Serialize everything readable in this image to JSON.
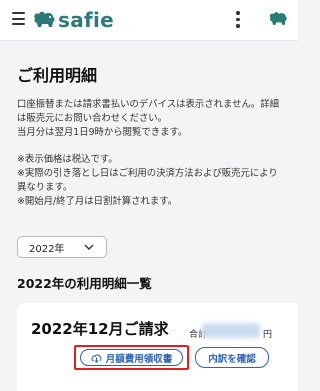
{
  "header": {
    "logo_text": "safie",
    "brand_color": "#2a7a77",
    "icons": [
      "menu-icon",
      "safie-logo-icon",
      "more-vertical-icon",
      "safie-mascot-icon"
    ]
  },
  "page": {
    "title": "ご利用明細",
    "desc_lines_1": "口座振替または請求書払いのデバイスは表示されません。詳細は販売元にお問い合わせください。",
    "desc_lines_2": "当月分は翌月1日9時から閲覧できます。",
    "notes_1": "※表示価格は税込です。",
    "notes_2": "※実際の引き落とし日はご利用の決済方法および販売元により異なります。",
    "notes_3": "※開始月/終了月は日割計算されます。"
  },
  "filter": {
    "year_selected": "2022年"
  },
  "list": {
    "section_title": "2022年の利用明細一覧",
    "items": [
      {
        "title": "2022年12月ご請求",
        "total_label": "合計",
        "total_unit": "円",
        "receipt_button": "月額費用領収書",
        "detail_button": "内訳を確認"
      }
    ]
  },
  "colors": {
    "accent_blue": "#2d63b5",
    "highlight_red": "#e02020"
  }
}
